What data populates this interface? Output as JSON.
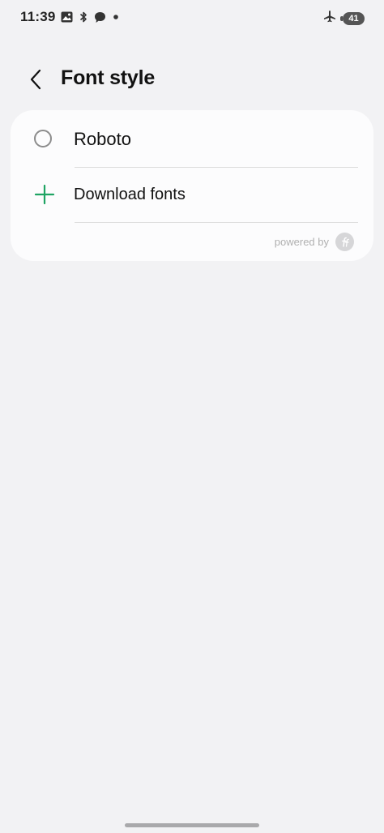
{
  "status_bar": {
    "time": "11:39",
    "battery_level": "41",
    "left_icons": [
      "gallery-icon",
      "bluetooth-icon",
      "chat-bubble-icon",
      "dot-icon"
    ],
    "right_icons": [
      "airplane-icon",
      "battery-icon"
    ]
  },
  "header": {
    "title": "Font style",
    "back_icon": "chevron-left-icon"
  },
  "font_list": {
    "items": [
      {
        "label": "Roboto",
        "icon": "radio-icon",
        "selected": false
      },
      {
        "label": "Download fonts",
        "icon": "plus-icon"
      }
    ],
    "powered_by_text": "powered by",
    "powered_by_logo": "ff-logo-icon",
    "accent_color": "#1fa463"
  }
}
